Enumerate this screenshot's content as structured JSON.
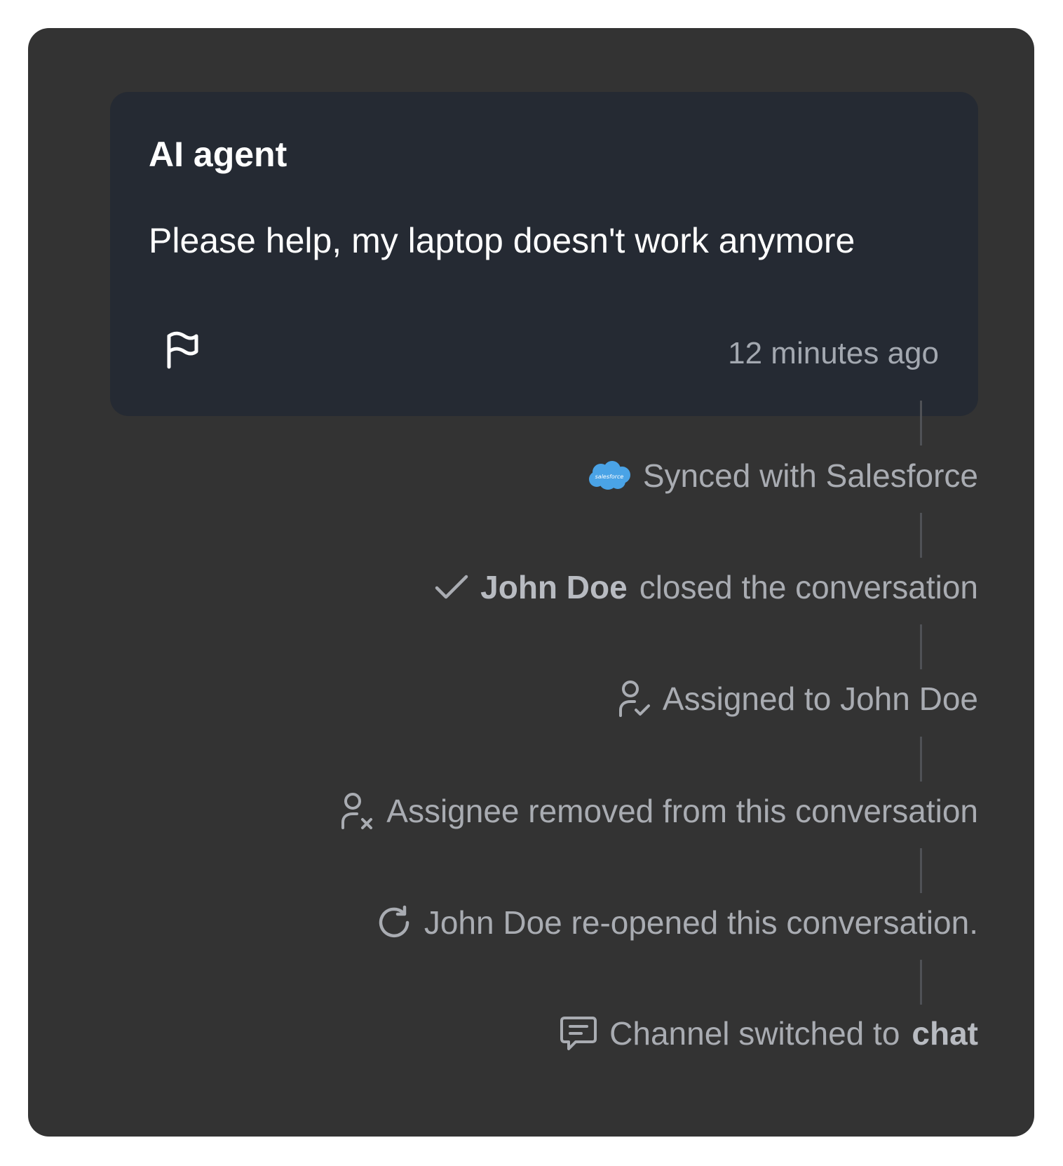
{
  "card": {
    "sender": "AI agent",
    "message": "Please help, my laptop doesn't work anymore",
    "timestamp": "12 minutes ago",
    "flag_icon": "flag-icon"
  },
  "events": {
    "salesforce": {
      "icon": "salesforce-icon",
      "logo_text": "salesforce",
      "text": "Synced with Salesforce"
    },
    "closed": {
      "icon": "check-icon",
      "actor": "John Doe",
      "text": "closed the conversation"
    },
    "assigned": {
      "icon": "user-check-icon",
      "text": "Assigned to John Doe"
    },
    "unassigned": {
      "icon": "user-x-icon",
      "text": "Assignee removed from this conversation"
    },
    "reopened": {
      "icon": "refresh-icon",
      "text": "John Doe re-opened this conversation."
    },
    "channel": {
      "icon": "chat-icon",
      "text": "Channel switched to",
      "channel": "chat"
    }
  },
  "colors": {
    "panel": "#333333",
    "card": "#252a33",
    "event_text": "#a9acb2",
    "salesforce_blue": "#4aa3e6"
  }
}
